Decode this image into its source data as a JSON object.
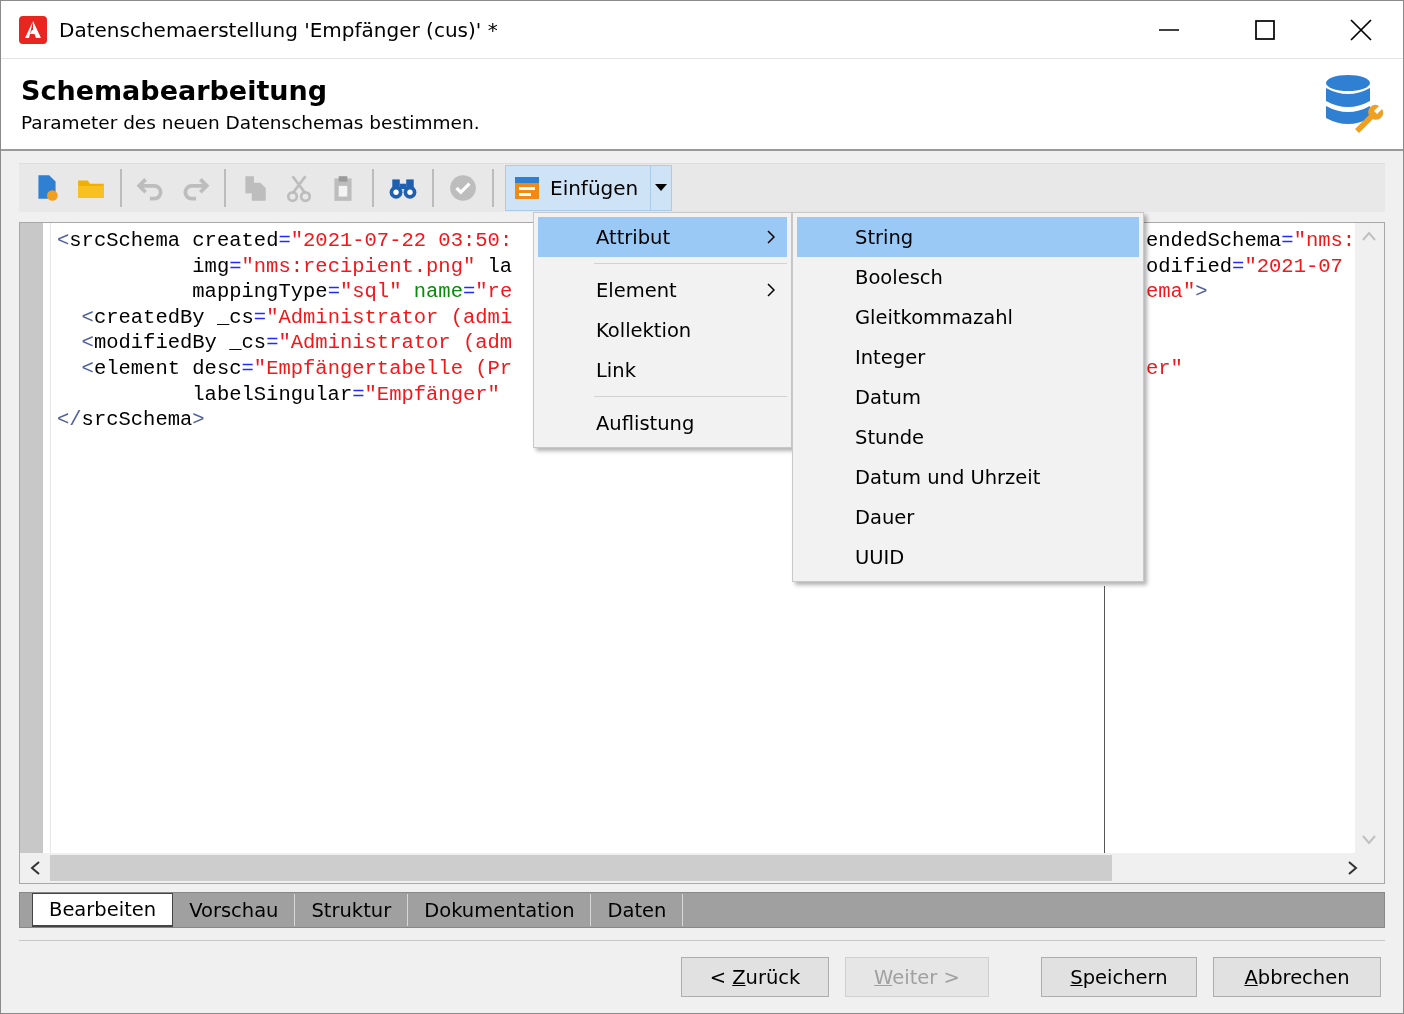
{
  "window": {
    "title": "Datenschemaerstellung 'Empfänger (cus)' *"
  },
  "header": {
    "title": "Schemabearbeitung",
    "subtitle": "Parameter des neuen Datenschemas bestimmen."
  },
  "toolbar": {
    "tools": [
      {
        "kind": "new",
        "disabled": false
      },
      {
        "kind": "open",
        "disabled": false
      },
      {
        "kind": "sep"
      },
      {
        "kind": "undo",
        "disabled": true
      },
      {
        "kind": "redo",
        "disabled": true
      },
      {
        "kind": "sep"
      },
      {
        "kind": "copy",
        "disabled": true
      },
      {
        "kind": "cut",
        "disabled": true
      },
      {
        "kind": "paste",
        "disabled": true
      },
      {
        "kind": "sep"
      },
      {
        "kind": "find",
        "disabled": false
      },
      {
        "kind": "sep"
      },
      {
        "kind": "check",
        "disabled": true
      },
      {
        "kind": "sep"
      }
    ],
    "insert": {
      "label": "Einfügen",
      "expanded": true
    }
  },
  "editor": {
    "lines": [
      {
        "kind": "root",
        "left": [
          {
            "kind": "punct",
            "s": "<"
          },
          {
            "kind": "name",
            "s": "srcSchema created"
          },
          {
            "kind": "equals",
            "s": "="
          },
          {
            "kind": "value",
            "s": "\"2021-07-22 03:50:"
          }
        ],
        "right": [
          {
            "kind": "name",
            "s": "endedSchema"
          },
          {
            "kind": "equals",
            "s": "="
          },
          {
            "kind": "value",
            "s": "\"nms:"
          }
        ]
      },
      {
        "kind": "cont",
        "left": [
          {
            "kind": "name",
            "s": "img"
          },
          {
            "kind": "equals",
            "s": "="
          },
          {
            "kind": "value",
            "s": "\"nms:recipient.png\""
          },
          {
            "kind": "name",
            "s": " la"
          }
        ],
        "right": [
          {
            "kind": "name",
            "s": "odified"
          },
          {
            "kind": "equals",
            "s": "="
          },
          {
            "kind": "value",
            "s": "\"2021-07"
          }
        ]
      },
      {
        "kind": "cont",
        "left": [
          {
            "kind": "name",
            "s": "mappingType"
          },
          {
            "kind": "equals",
            "s": "="
          },
          {
            "kind": "value",
            "s": "\"sql\" "
          },
          {
            "kind": "key",
            "s": "name"
          },
          {
            "kind": "equals",
            "s": "="
          },
          {
            "kind": "value",
            "s": "\"re"
          }
        ],
        "right": [
          {
            "kind": "value",
            "s": "ema\""
          },
          {
            "kind": "punct",
            "s": ">"
          }
        ]
      },
      {
        "kind": "child",
        "left": [
          {
            "kind": "punct",
            "s": "<"
          },
          {
            "kind": "name",
            "s": "createdBy _cs"
          },
          {
            "kind": "equals",
            "s": "="
          },
          {
            "kind": "value",
            "s": "\"Administrator (admi"
          }
        ]
      },
      {
        "kind": "child",
        "left": [
          {
            "kind": "punct",
            "s": "<"
          },
          {
            "kind": "name",
            "s": "modifiedBy _cs"
          },
          {
            "kind": "equals",
            "s": "="
          },
          {
            "kind": "value",
            "s": "\"Administrator (adm"
          }
        ]
      },
      {
        "kind": "child",
        "left": [
          {
            "kind": "punct",
            "s": "<"
          },
          {
            "kind": "name",
            "s": "element desc"
          },
          {
            "kind": "equals",
            "s": "="
          },
          {
            "kind": "value",
            "s": "\"Empfängertabelle (Pr"
          }
        ],
        "right": [
          {
            "kind": "value",
            "s": "er\""
          }
        ]
      },
      {
        "kind": "cont",
        "left": [
          {
            "kind": "name",
            "s": "labelSingular"
          },
          {
            "kind": "equals",
            "s": "="
          },
          {
            "kind": "value",
            "s": "\"Empfänger\""
          }
        ]
      },
      {
        "kind": "root",
        "left": [
          {
            "kind": "punct",
            "s": "</"
          },
          {
            "kind": "name",
            "s": "srcSchema"
          },
          {
            "kind": "punct",
            "s": ">"
          }
        ]
      }
    ]
  },
  "menu": {
    "items": [
      {
        "kind": "item",
        "label": "Attribut",
        "submenu": true,
        "selected": true
      },
      {
        "kind": "sep"
      },
      {
        "kind": "item",
        "label": "Element",
        "submenu": true,
        "selected": false
      },
      {
        "kind": "item",
        "label": "Kollektion",
        "submenu": false,
        "selected": false
      },
      {
        "kind": "item",
        "label": "Link",
        "submenu": false,
        "selected": false
      },
      {
        "kind": "sep"
      },
      {
        "kind": "item",
        "label": "Auflistung",
        "submenu": false,
        "selected": false
      }
    ]
  },
  "submenu": {
    "items": [
      {
        "label": "String",
        "selected": true
      },
      {
        "label": "Boolesch",
        "selected": false
      },
      {
        "label": "Gleitkommazahl",
        "selected": false
      },
      {
        "label": "Integer",
        "selected": false
      },
      {
        "label": "Datum",
        "selected": false
      },
      {
        "label": "Stunde",
        "selected": false
      },
      {
        "label": "Datum und Uhrzeit",
        "selected": false
      },
      {
        "label": "Dauer",
        "selected": false
      },
      {
        "label": "UUID",
        "selected": false
      }
    ]
  },
  "tabs": [
    {
      "label": "Bearbeiten",
      "selected": true
    },
    {
      "label": "Vorschau",
      "selected": false
    },
    {
      "label": "Struktur",
      "selected": false
    },
    {
      "label": "Dokumentation",
      "selected": false
    },
    {
      "label": "Daten",
      "selected": false
    }
  ],
  "buttons": [
    {
      "before": "< ",
      "key": "Z",
      "after": "urück",
      "disabled": false
    },
    {
      "key": "W",
      "after": "eiter >",
      "disabled": true
    },
    {
      "key": "S",
      "after": "peichern",
      "disabled": false
    },
    {
      "key": "A",
      "after": "bbrechen",
      "disabled": false
    }
  ]
}
